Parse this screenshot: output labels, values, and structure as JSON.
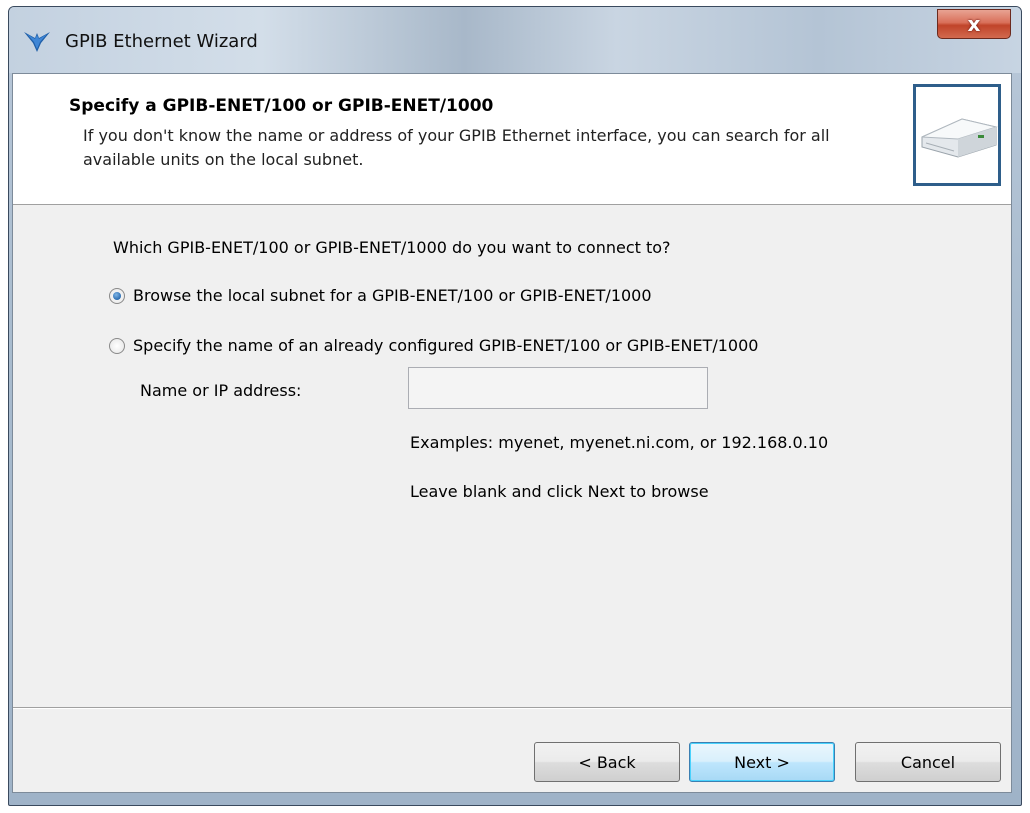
{
  "window": {
    "title": "GPIB Ethernet Wizard",
    "close_glyph": "x",
    "icon": "ni-eagle-icon"
  },
  "header": {
    "title": "Specify a GPIB-ENET/100 or GPIB-ENET/1000",
    "description": "If you don't know the name or address of your GPIB Ethernet interface, you can search for all available units on the local subnet.",
    "image": "ethernet-device-icon"
  },
  "body": {
    "question": "Which GPIB-ENET/100 or GPIB-ENET/1000 do you want to connect to?",
    "options": [
      {
        "label": "Browse the local subnet for a GPIB-ENET/100 or GPIB-ENET/1000",
        "selected": true
      },
      {
        "label": "Specify the name of an already configured GPIB-ENET/100 or GPIB-ENET/1000",
        "selected": false
      }
    ],
    "name_label": "Name or IP address:",
    "name_value": "",
    "examples": "Examples: myenet, myenet.ni.com, or 192.168.0.10",
    "hint": "Leave blank and click Next to browse"
  },
  "buttons": {
    "back": "< Back",
    "next": "Next >",
    "cancel": "Cancel"
  },
  "colors": {
    "accent": "#2e5e8a",
    "close": "#c0442a"
  }
}
